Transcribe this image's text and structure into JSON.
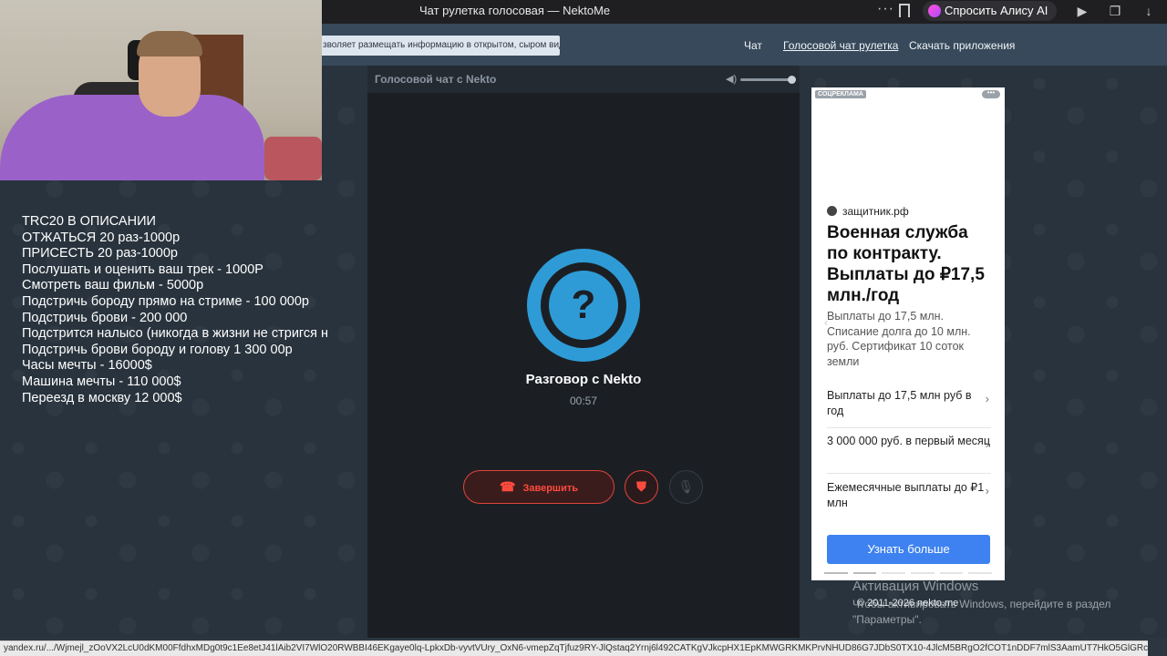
{
  "browser": {
    "tab_title": "Чат рулетка голосовая — NektoMe",
    "alice_label": "Спросить Алису AI"
  },
  "site": {
    "notice": "зволяет размещать информацию в открытом, сыром виде!",
    "nav": [
      {
        "label": "Чат",
        "active": false
      },
      {
        "label": "Голосовой чат рулетка",
        "active": true
      },
      {
        "label": "Скачать приложения",
        "active": false
      }
    ]
  },
  "overlay": {
    "lines": [
      "TRC20 В ОПИСАНИИ",
      "ОТЖАТЬСЯ 20 раз-1000р",
      "ПРИСЕСТЬ 20 раз-1000р",
      "Послушать и оценить ваш трек - 1000Р",
      "Смотреть ваш фильм - 5000р",
      "Подстричь бороду прямо на стриме - 100 000р",
      "Подстричь брови - 200 000",
      "Подстрится налысо (никогда в жизни не стригся н",
      "Подстричь брови бороду и голову 1 300 00р",
      "Часы мечты - 16000$",
      "Машина мечты - 110 000$",
      "Переезд в москву 12 000$"
    ]
  },
  "chat": {
    "header_label": "Голосовой чат с Nekto",
    "volume_level": 0.92,
    "conversation_title": "Разговор с Nekto",
    "timer": "00:57",
    "avatar_symbol": "?",
    "end_label": "Завершить",
    "accent_color": "#2e9bd6",
    "danger_color": "#e0443a"
  },
  "ad": {
    "tag": "СОЦРЕКЛАМА",
    "more": "•••",
    "domain": "защитник.рф",
    "headline": "Военная служба по контракту. Выплаты до ₽17,5 млн./год",
    "description": "Выплаты до 17,5 млн. Списание долга до 10 млн. руб. Сертификат 10 соток земли",
    "rows": [
      "Выплаты до 17,5 млн руб в год",
      "3 000 000 руб. в первый месяц",
      "Ежемесячные выплаты до ₽1 млн"
    ],
    "cta": "Узнать больше"
  },
  "watermark": {
    "title": "Активация Windows",
    "subtitle": "Чтобы активировать Windows, перейдите в раздел \"Параметры\".",
    "copyright": "© 2011-2026 nekto.me"
  },
  "status_url": "yandex.ru/.../Wjmejl_zOoVX2LcU0dKM00FfdhxMDg0t9c1Ee8etJ41lAib2VI7WlO20RWBBI46EKgaye0lq-LpkxDb-vyvtVUry_OxN6-vmepZqTjfuz9RY-JlQstaq2Yrnj6l492CATKgVJkcpHX1EpKMWGRKMKPrvNHUD86G7JDbS0TX10-4JlcM5BRgO2fCOT1nDDF7mlS3AamUT7HkO5GlGRc"
}
